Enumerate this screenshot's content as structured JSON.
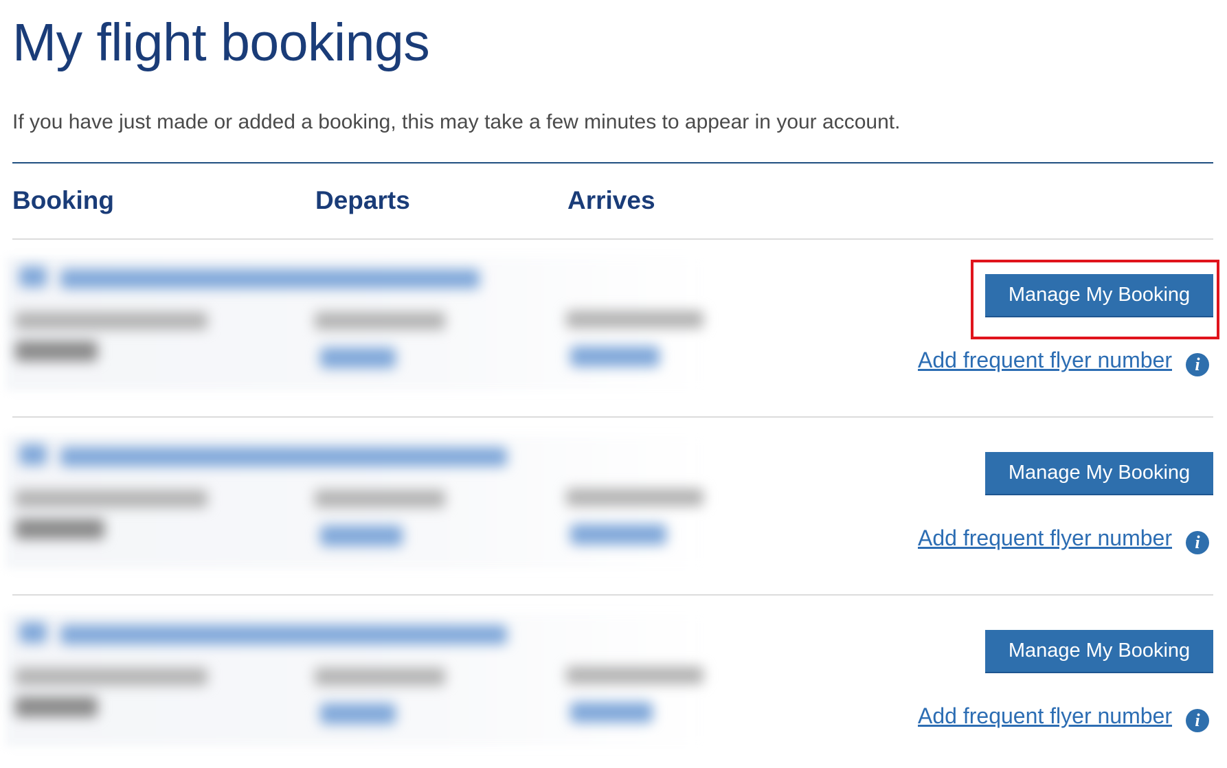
{
  "page": {
    "title": "My flight bookings",
    "notice": "If you have just made or added a booking, this may take a few minutes to appear in your account."
  },
  "table": {
    "columns": [
      {
        "label": "Booking"
      },
      {
        "label": "Departs"
      },
      {
        "label": "Arrives"
      }
    ]
  },
  "bookings": [
    {
      "manage_label": "Manage My Booking",
      "frequent_flyer_label": "Add frequent flyer number",
      "details_visible": false
    },
    {
      "manage_label": "Manage My Booking",
      "frequent_flyer_label": "Add frequent flyer number",
      "details_visible": false
    },
    {
      "manage_label": "Manage My Booking",
      "frequent_flyer_label": "Add frequent flyer number",
      "details_visible": false
    }
  ],
  "icons": {
    "info": "info-icon",
    "info_glyph": "i"
  },
  "colors": {
    "title": "#1a3c78",
    "button": "#2e6fad",
    "link": "#2c6db3",
    "highlight": "#e0141c"
  }
}
